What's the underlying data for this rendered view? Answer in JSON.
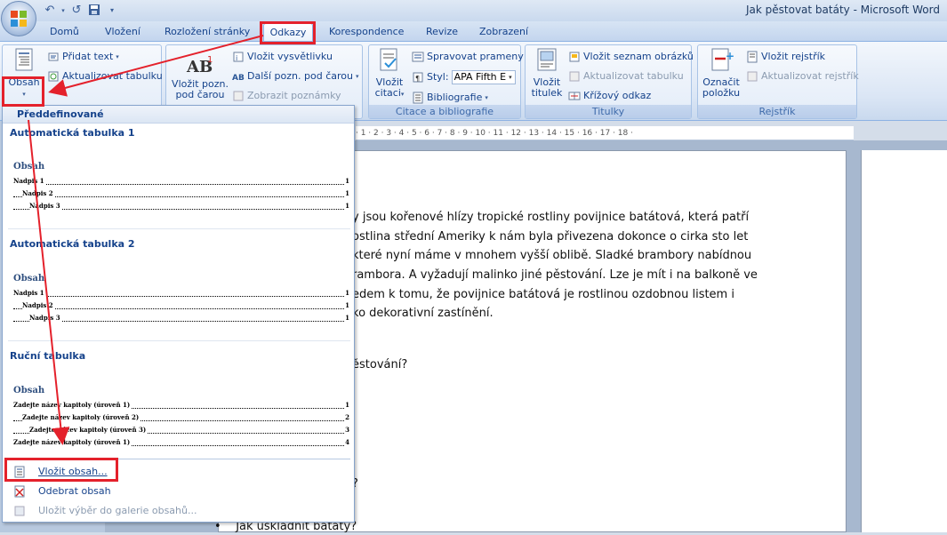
{
  "window": {
    "title": "Jak pěstovat batáty - Microsoft Word"
  },
  "tabs": [
    "Domů",
    "Vložení",
    "Rozložení stránky",
    "Odkazy",
    "Korespondence",
    "Revize",
    "Zobrazení"
  ],
  "active_tab": "Odkazy",
  "ribbon": {
    "obsah": {
      "big_label": "Obsah",
      "add_text": "Přidat text",
      "update_table": "Aktualizovat tabulku"
    },
    "footnotes": {
      "insert_footnote_l1": "Vložit pozn.",
      "insert_footnote_l2": "pod čarou",
      "insert_endnote": "Vložit vysvětlivku",
      "next_footnote": "Další pozn. pod čarou",
      "show_notes": "Zobrazit poznámky"
    },
    "citations": {
      "insert_citation_l1": "Vložit",
      "insert_citation_l2": "citaci",
      "manage_sources": "Spravovat prameny",
      "style_label": "Styl:",
      "style_value": "APA Fifth E",
      "bibliography": "Bibliografie",
      "group_label": "Citace a bibliografie"
    },
    "captions": {
      "insert_caption_l1": "Vložit",
      "insert_caption_l2": "titulek",
      "insert_table_of_figures": "Vložit seznam obrázků",
      "update_table": "Aktualizovat tabulku",
      "cross_reference": "Křížový odkaz",
      "group_label": "Titulky"
    },
    "index": {
      "mark_entry_l1": "Označit",
      "mark_entry_l2": "položku",
      "insert_index": "Vložit rejstřík",
      "update_index": "Aktualizovat rejstřík",
      "group_label": "Rejstřík"
    }
  },
  "ruler": "· 1 · 2 · 3 · 4 · 5 · 6 · 7 · 8 · 9 · 10 · 11 · 12 · 13 · 14 · 15 · 16 · 17 · 18 ·",
  "dropdown": {
    "header": "Předdefinované",
    "sections": [
      {
        "title": "Automatická tabulka 1",
        "heading": "Obsah",
        "entries": [
          {
            "text": "Nadpis 1",
            "page": "1"
          },
          {
            "text": "Nadpis 2",
            "page": "1"
          },
          {
            "text": "Nadpis 3",
            "page": "1"
          }
        ]
      },
      {
        "title": "Automatická tabulka 2",
        "heading": "Obsah",
        "entries": [
          {
            "text": "Nadpis 1",
            "page": "1"
          },
          {
            "text": "Nadpis 2",
            "page": "1"
          },
          {
            "text": "Nadpis 3",
            "page": "1"
          }
        ]
      },
      {
        "title": "Ruční tabulka",
        "heading": "Obsah",
        "entries": [
          {
            "text": "Zadejte název kapitoly (úroveň 1)",
            "page": "1"
          },
          {
            "text": "Zadejte název kapitoly (úroveň 2)",
            "page": "2"
          },
          {
            "text": "Zadejte název kapitoly (úroveň 3)",
            "page": "3"
          },
          {
            "text": "Zadejte název kapitoly (úroveň 1)",
            "page": "4"
          }
        ]
      }
    ],
    "menu": {
      "insert_toc": "Vložit obsah...",
      "remove_toc": "Odebrat obsah",
      "save_selection": "Uložit výběr do galerie obsahů..."
    }
  },
  "document": {
    "lines": [
      "y jsou kořenové hlízy tropické rostliny povijnice batátová, která patří",
      "ostlina  střední Ameriky k nám byla přivezena dokonce o cirka sto let",
      "které nyní máme v mnohem vyšší oblibě. Sladké brambory nabídnou",
      "rambora.  A vyžadují malinko  jiné pěstování.  Lze je mít i na balkoně ve",
      "edem k tomu, že povijnice batátová je rostlinou ozdobnou listem i",
      "ko dekorativní  zastínění."
    ],
    "heading_fragment": "ěstování?",
    "partial_q": "?",
    "bullet": "Jak uskladnit  batáty?"
  },
  "colors": {
    "highlight": "#e4212b",
    "ribbon_text": "#15428b"
  }
}
